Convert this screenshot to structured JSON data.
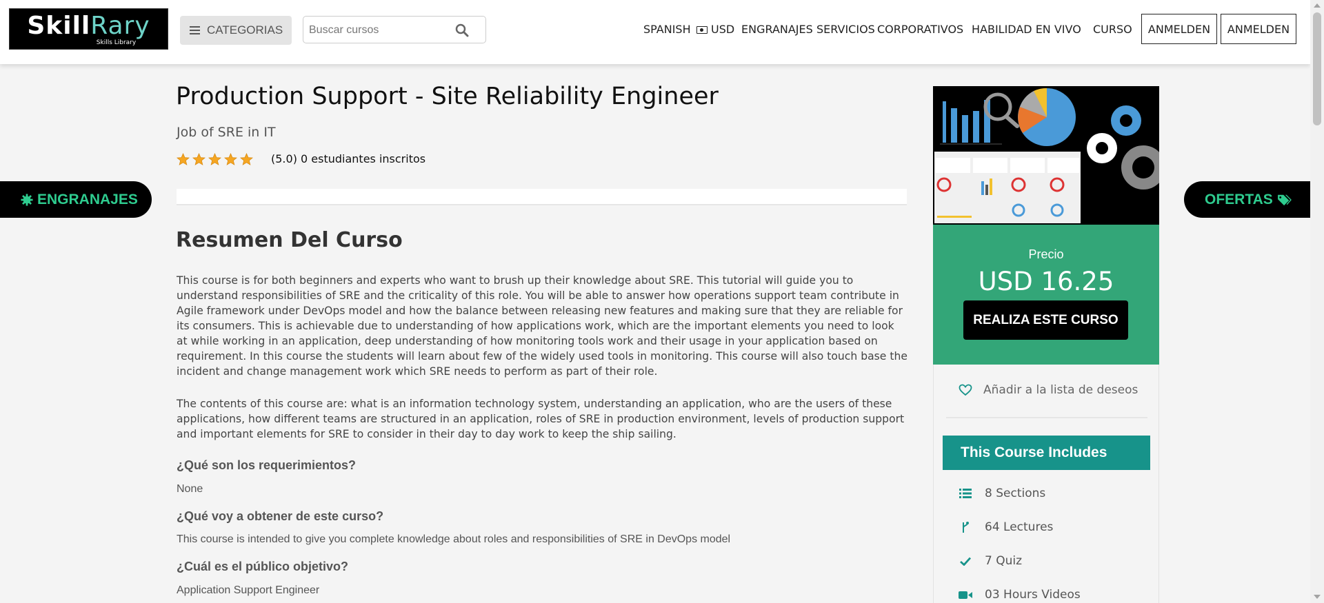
{
  "header": {
    "logo_main_a": "Skill",
    "logo_main_b": "Rary",
    "logo_sub": "Skills Library",
    "categories_label": "CATEGORIAS",
    "search_placeholder": "Buscar cursos",
    "nav": {
      "language": "SPANISH",
      "currency": "USD",
      "engranajes": "ENGRANAJES",
      "servicios": "SERVICIOS",
      "corporativos": "CORPORATIVOS",
      "habilidad": "HABILIDAD EN VIVO",
      "curso": "CURSO",
      "anmelden_1": "ANMELDEN",
      "anmelden_2": "ANMELDEN"
    }
  },
  "side_tabs": {
    "left": "ENGRANAJES",
    "right": "OFERTAS"
  },
  "course": {
    "title": "Production Support - Site Reliability Engineer",
    "subtitle": "Job of SRE in IT",
    "rating_stars": 5,
    "rating_text": "(5.0) 0 estudiantes inscritos",
    "overview_heading": "Resumen Del Curso",
    "paragraph_1": "This course is for both beginners and experts who want to brush up their knowledge about SRE. This tutorial will guide you to understand responsibilities of SRE and the criticality of this role. You will be able to answer how operations support team contribute in Agile framework under DevOps model and how the balance between releasing new features and making sure that they are reliable for its consumers. This is achievable due to understanding of how applications work, which are the important elements you need to look at while working in an application, deep understanding of how monitoring tools work and their usage in your application based on requirement. In this course the students will learn about few of the widely used tools in monitoring. This course will also touch base the incident and change management work which SRE needs to perform as part of their role.",
    "paragraph_2": "The contents of this course are: what is an information technology system, understanding an application, who are the users of these applications, how different teams are structured in an application, roles of SRE in production environment, levels of production support and important elements for SRE to consider in their day to day work to keep the ship sailing.",
    "q1": "¿Qué son los requerimientos?",
    "a1": "None",
    "q2": "¿Qué voy a obtener de este curso?",
    "a2": "This course is intended to give you complete knowledge about roles and responsibilities of SRE in DevOps model",
    "q3": "¿Cuál es el público objetivo?",
    "a3": "Application Support Engineer"
  },
  "sidebar": {
    "price_label": "Precio",
    "price_value": "USD 16.25",
    "take_course": "REALIZA ESTE CURSO",
    "wishlist": "Añadir a la lista de deseos",
    "includes_heading": "This Course Includes",
    "includes": [
      {
        "icon": "list-icon",
        "label": "8 Sections"
      },
      {
        "icon": "branch-icon",
        "label": "64 Lectures"
      },
      {
        "icon": "check-icon",
        "label": "7 Quiz"
      },
      {
        "icon": "video-icon",
        "label": "03 Hours Videos"
      }
    ]
  },
  "colors": {
    "accent_green": "#33a678",
    "teal": "#17938a",
    "side_tab_text": "#2ecc8f",
    "star": "#f5a623"
  }
}
